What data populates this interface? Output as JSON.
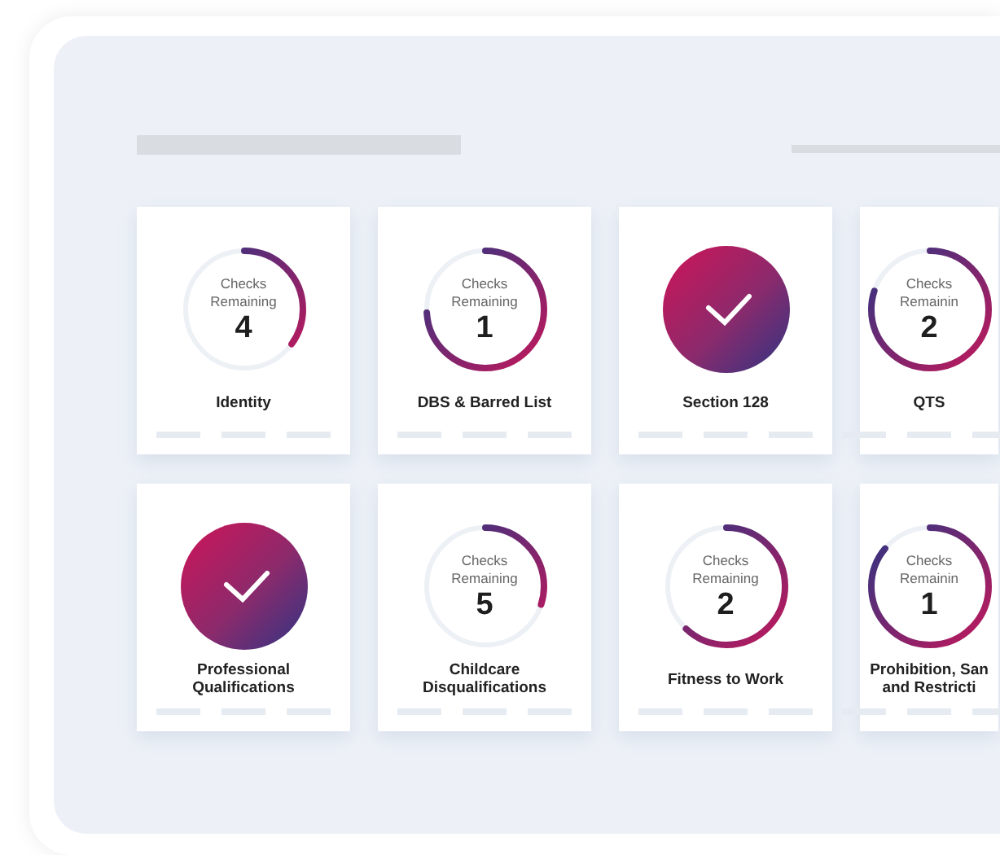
{
  "cards": [
    {
      "kind": "progress",
      "caption": "Checks Remaining",
      "count": "4",
      "level": 0.35,
      "title": "Identity"
    },
    {
      "kind": "progress",
      "caption": "Checks Remaining",
      "count": "1",
      "level": 0.74,
      "title": "DBS & Barred List"
    },
    {
      "kind": "done",
      "title": "Section 128"
    },
    {
      "kind": "progress",
      "caption": "Checks Remainin",
      "count": "2",
      "level": 0.8,
      "title": "QTS"
    },
    {
      "kind": "done",
      "title": "Professional Qualifications"
    },
    {
      "kind": "progress",
      "caption": "Checks Remaining",
      "count": "5",
      "level": 0.3,
      "title": "Childcare Disqualifications"
    },
    {
      "kind": "progress",
      "caption": "Checks Remaining",
      "count": "2",
      "level": 0.62,
      "title": "Fitness to Work"
    },
    {
      "kind": "progress",
      "caption": "Checks Remainin",
      "count": "1",
      "level": 0.86,
      "title": "Prohibition, San and Restricti"
    }
  ]
}
